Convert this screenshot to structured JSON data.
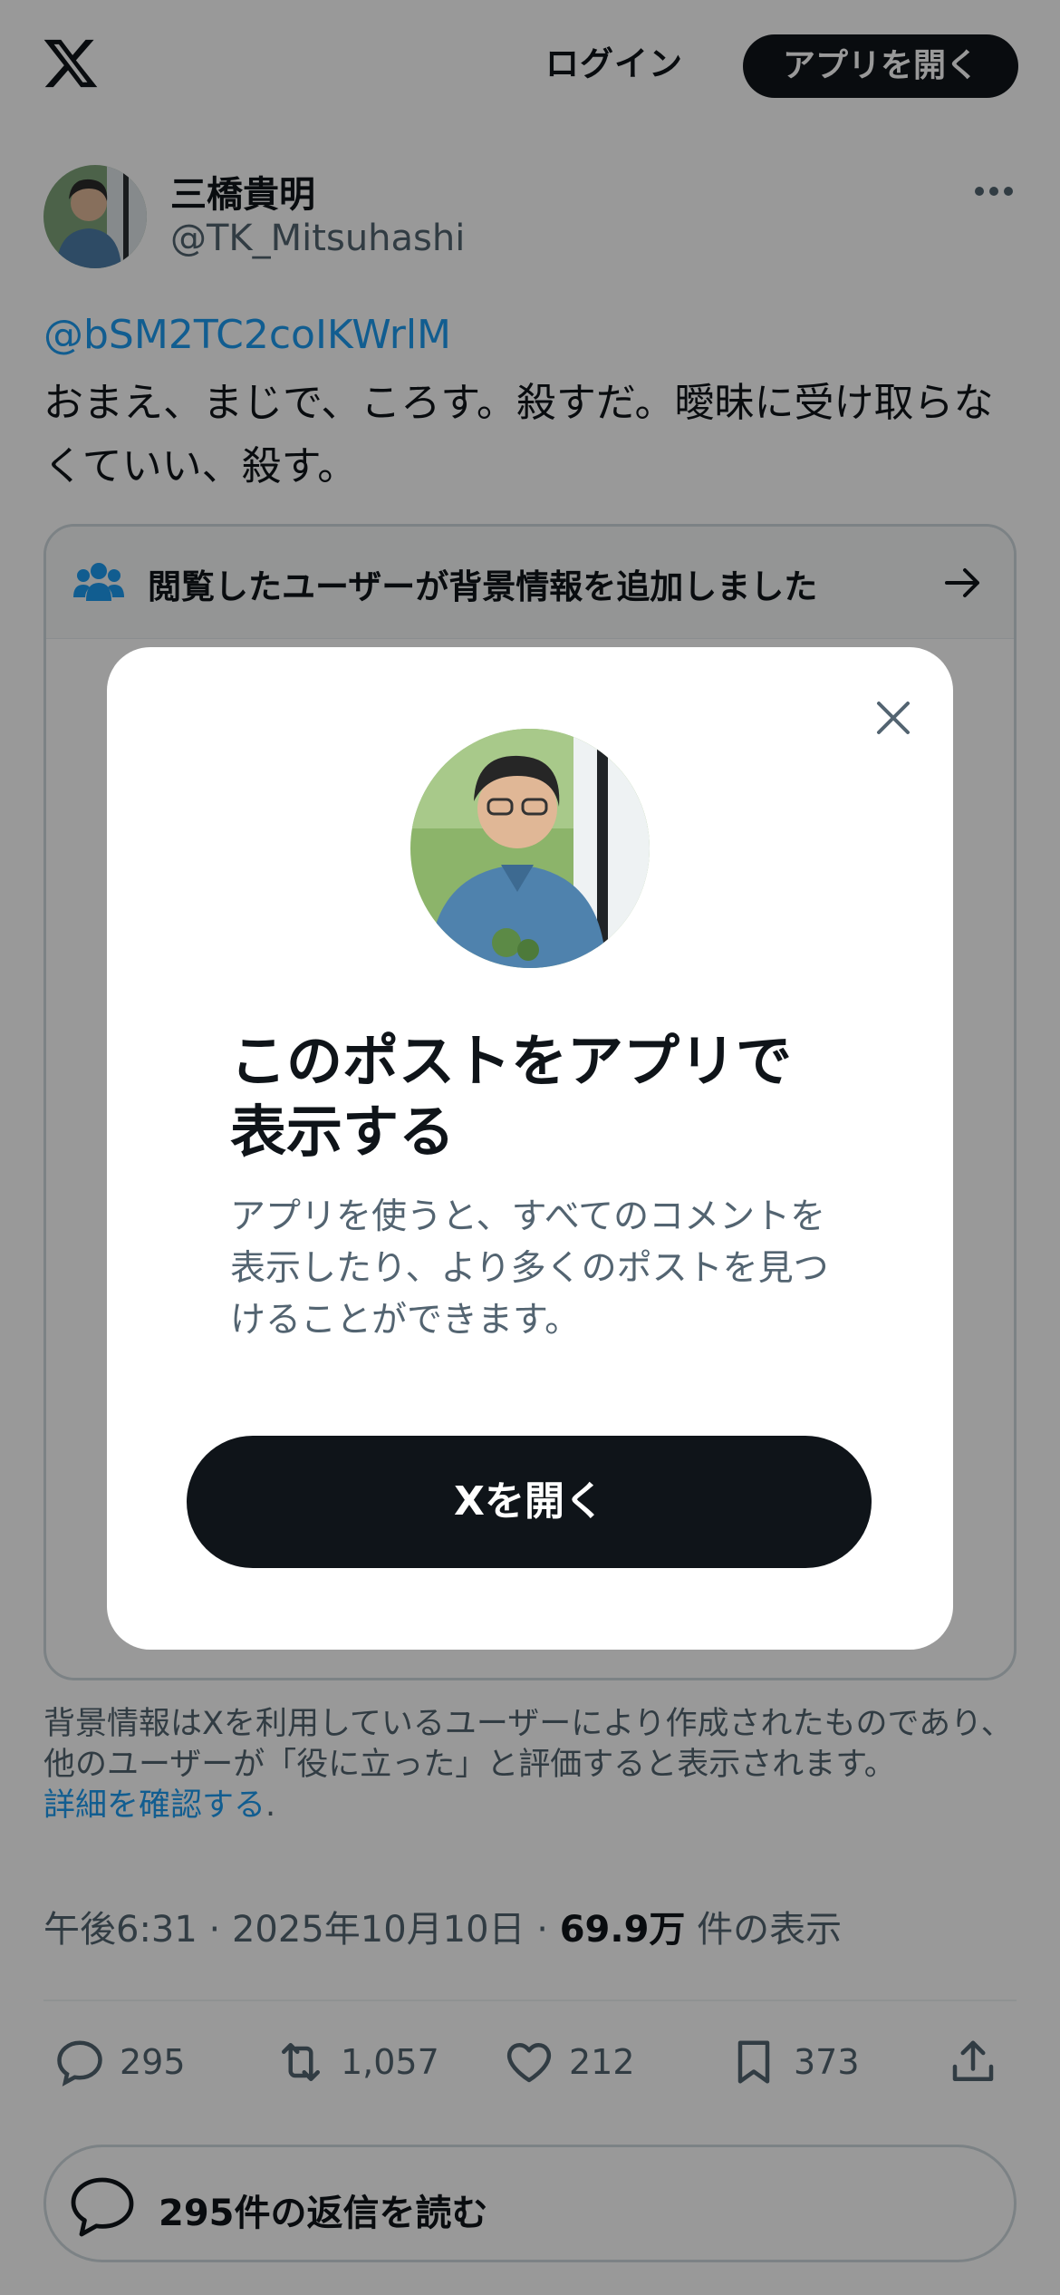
{
  "header": {
    "logo": "x-logo-icon",
    "login_label": "ログイン",
    "open_app_label": "アプリを開く"
  },
  "post": {
    "author_name": "三橋貴明",
    "author_handle": "@TK_Mitsuhashi",
    "mention": "@bSM2TC2coIKWrlM",
    "text": "おまえ、まじで、ころす。殺すだ。曖昧に受け取らなくていい、殺す。",
    "timestamp": "午後6:31 · 2025年10月10日 · ",
    "views_count": "69.9万",
    "views_suffix": " 件の表示"
  },
  "community_note": {
    "title": "閲覧したユーザーが背景情報を追加しました",
    "footer_text": "背景情報はXを利用しているユーザーにより作成されたものであり、他のユーザーが「役に立った」と評価すると表示されます。",
    "footer_link": "詳細を確認する",
    "footer_link_suffix": "."
  },
  "actions": {
    "replies": "295",
    "reposts": "1,057",
    "likes": "212",
    "bookmarks": "373"
  },
  "read_replies_label": "295件の返信を読む",
  "modal": {
    "title": "このポストをアプリで表示する",
    "description": "アプリを使うと、すべてのコメントを表示したり、より多くのポストを見つけることができます。",
    "button_label": "Xを開く"
  },
  "colors": {
    "accent": "#1d9bf0",
    "text": "#0f1419",
    "secondary": "#536471",
    "button_dark": "#0f1419"
  }
}
